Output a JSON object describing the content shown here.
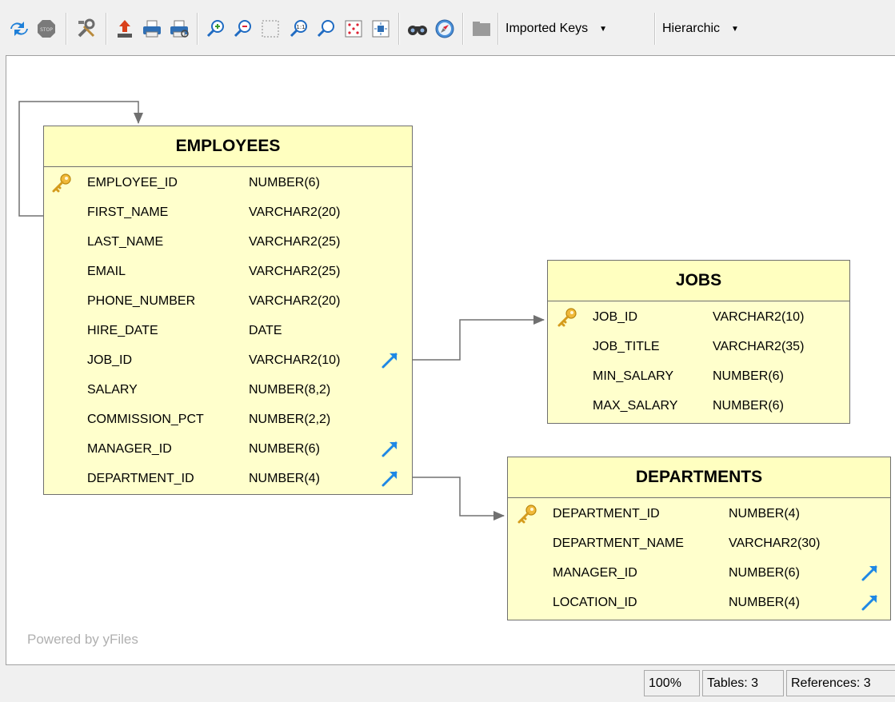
{
  "toolbar": {
    "icons": [
      "refresh-icon",
      "stop-icon",
      "tools-icon",
      "export-icon",
      "print-icon",
      "print-preview-icon",
      "zoom-in-icon",
      "zoom-out-icon",
      "zoom-area-icon",
      "zoom-actual-icon",
      "zoom-search-icon",
      "fit-content-icon",
      "fit-selection-icon",
      "binoculars-icon",
      "navigator-icon",
      "layers-icon"
    ],
    "relationship_mode": "Imported Keys",
    "layout_mode": "Hierarchic"
  },
  "diagram": {
    "tables": [
      {
        "name": "EMPLOYEES",
        "columns": [
          {
            "name": "EMPLOYEE_ID",
            "type": "NUMBER(6)",
            "pk": true,
            "fk": false
          },
          {
            "name": "FIRST_NAME",
            "type": "VARCHAR2(20)",
            "pk": false,
            "fk": false
          },
          {
            "name": "LAST_NAME",
            "type": "VARCHAR2(25)",
            "pk": false,
            "fk": false
          },
          {
            "name": "EMAIL",
            "type": "VARCHAR2(25)",
            "pk": false,
            "fk": false
          },
          {
            "name": "PHONE_NUMBER",
            "type": "VARCHAR2(20)",
            "pk": false,
            "fk": false
          },
          {
            "name": "HIRE_DATE",
            "type": "DATE",
            "pk": false,
            "fk": false
          },
          {
            "name": "JOB_ID",
            "type": "VARCHAR2(10)",
            "pk": false,
            "fk": true
          },
          {
            "name": "SALARY",
            "type": "NUMBER(8,2)",
            "pk": false,
            "fk": false
          },
          {
            "name": "COMMISSION_PCT",
            "type": "NUMBER(2,2)",
            "pk": false,
            "fk": false
          },
          {
            "name": "MANAGER_ID",
            "type": "NUMBER(6)",
            "pk": false,
            "fk": true
          },
          {
            "name": "DEPARTMENT_ID",
            "type": "NUMBER(4)",
            "pk": false,
            "fk": true
          }
        ]
      },
      {
        "name": "JOBS",
        "columns": [
          {
            "name": "JOB_ID",
            "type": "VARCHAR2(10)",
            "pk": true,
            "fk": false
          },
          {
            "name": "JOB_TITLE",
            "type": "VARCHAR2(35)",
            "pk": false,
            "fk": false
          },
          {
            "name": "MIN_SALARY",
            "type": "NUMBER(6)",
            "pk": false,
            "fk": false
          },
          {
            "name": "MAX_SALARY",
            "type": "NUMBER(6)",
            "pk": false,
            "fk": false
          }
        ]
      },
      {
        "name": "DEPARTMENTS",
        "columns": [
          {
            "name": "DEPARTMENT_ID",
            "type": "NUMBER(4)",
            "pk": true,
            "fk": false
          },
          {
            "name": "DEPARTMENT_NAME",
            "type": "VARCHAR2(30)",
            "pk": false,
            "fk": false
          },
          {
            "name": "MANAGER_ID",
            "type": "NUMBER(6)",
            "pk": false,
            "fk": true
          },
          {
            "name": "LOCATION_ID",
            "type": "NUMBER(4)",
            "pk": false,
            "fk": true
          }
        ]
      }
    ],
    "relations": [
      {
        "from": "EMPLOYEES.MANAGER_ID",
        "to": "EMPLOYEES.EMPLOYEE_ID"
      },
      {
        "from": "EMPLOYEES.JOB_ID",
        "to": "JOBS.JOB_ID"
      },
      {
        "from": "EMPLOYEES.DEPARTMENT_ID",
        "to": "DEPARTMENTS.DEPARTMENT_ID"
      }
    ],
    "watermark": "Powered by yFiles"
  },
  "status": {
    "zoom": "100%",
    "tables": "Tables: 3",
    "references": "References: 3"
  },
  "colors": {
    "table_fill": "#ffffcc",
    "table_border": "#6f6f6f",
    "edge": "#707070",
    "fk_arrow": "#1e88e5",
    "pk_key": "#e5a912"
  }
}
